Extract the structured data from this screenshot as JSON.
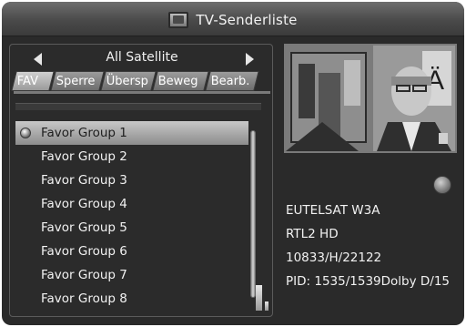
{
  "title": "TV-Senderliste",
  "satellite": "All Satellite",
  "tabs": [
    {
      "label": "FAV",
      "active": true
    },
    {
      "label": "Sperre",
      "active": false
    },
    {
      "label": "Übersp",
      "active": false
    },
    {
      "label": "Beweg",
      "active": false
    },
    {
      "label": "Bearb.",
      "active": false
    }
  ],
  "groups": [
    {
      "label": "Favor Group 1",
      "selected": true
    },
    {
      "label": "Favor Group 2",
      "selected": false
    },
    {
      "label": "Favor Group 3",
      "selected": false
    },
    {
      "label": "Favor Group 4",
      "selected": false
    },
    {
      "label": "Favor Group 5",
      "selected": false
    },
    {
      "label": "Favor Group 6",
      "selected": false
    },
    {
      "label": "Favor Group 7",
      "selected": false
    },
    {
      "label": "Favor Group 8",
      "selected": false
    }
  ],
  "channel_info": {
    "satellite": "EUTELSAT W3A",
    "channel": "RTL2 HD",
    "transponder": "10833/H/22122",
    "pid": "PID: 1535/1539Dolby D/15"
  },
  "icons": {
    "title": "tv-icon",
    "prev": "arrow-left-icon",
    "next": "arrow-right-icon",
    "bullet": "favorite-bullet-icon",
    "button": "round-button-icon"
  }
}
